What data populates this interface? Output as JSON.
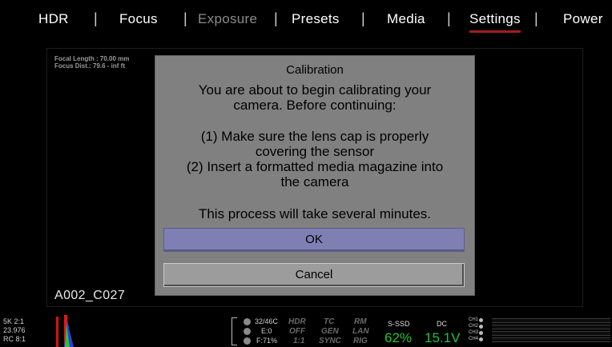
{
  "top_menu": {
    "items": [
      {
        "label": "HDR",
        "state": "normal"
      },
      {
        "label": "Focus",
        "state": "normal"
      },
      {
        "label": "Exposure",
        "state": "disabled"
      },
      {
        "label": "Presets",
        "state": "normal"
      },
      {
        "label": "Media",
        "state": "normal"
      },
      {
        "label": "Settings",
        "state": "active"
      },
      {
        "label": "Power",
        "state": "normal"
      }
    ],
    "separator": "|",
    "active_color": "#a21d1d"
  },
  "viewfinder": {
    "focal_length": "Focal Length : 70.00 mm",
    "focus_dist": "Focus Dist.: 79.6 - inf ft",
    "clip_name": "A002_C027"
  },
  "dialog": {
    "title": "Calibration",
    "lines": [
      "You are about to begin calibrating your",
      "camera.  Before continuing:",
      "(1) Make sure the lens cap is properly",
      "covering the sensor",
      "(2) Insert a formatted media magazine into",
      "the camera",
      "This process will take several minutes."
    ],
    "ok_label": "OK",
    "cancel_label": "Cancel",
    "ok_color": "#7f7fb3"
  },
  "status": {
    "format_lines": [
      "5K 2:1",
      "23.976",
      "RC 8:1"
    ],
    "sensor_info": [
      "32/46C",
      "E:0",
      "F:71%"
    ],
    "flags_row1": [
      "HDR",
      "TC",
      "RM"
    ],
    "flags_row2": [
      "OFF",
      "GEN",
      "LAN"
    ],
    "flags_row3": [
      "1:1",
      "SYNC",
      "RIG"
    ],
    "ssd_label": "S-SSD",
    "ssd_value": "62%",
    "dc_label": "DC",
    "dc_value": "15.1V",
    "channels": [
      "CH1",
      "CH2",
      "CH3",
      "CH4"
    ],
    "value_color": "#23c23a"
  }
}
